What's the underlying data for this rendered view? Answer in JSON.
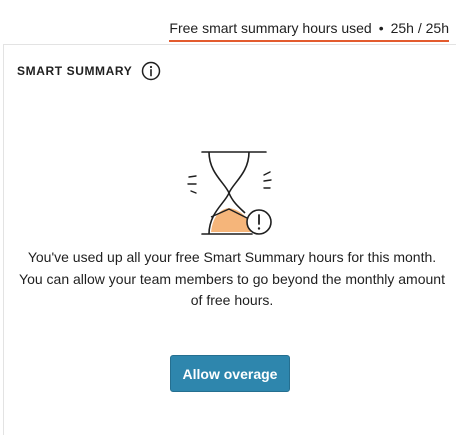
{
  "usage": {
    "label": "Free smart summary hours used",
    "separator": "•",
    "value": "25h / 25h"
  },
  "panel": {
    "title": "SMART SUMMARY",
    "info_icon": "info-icon",
    "illustration_icon": "hourglass-warning-icon",
    "message_line1": "You've used up all your free Smart Summary hours for this month.",
    "message_line2": "You can allow your team members to go beyond the monthly amount of free hours.",
    "button_label": "Allow overage"
  },
  "colors": {
    "accent_underline": "#e35b2e",
    "button": "#2e86ad",
    "hourglass_sand": "#f5b57a"
  }
}
